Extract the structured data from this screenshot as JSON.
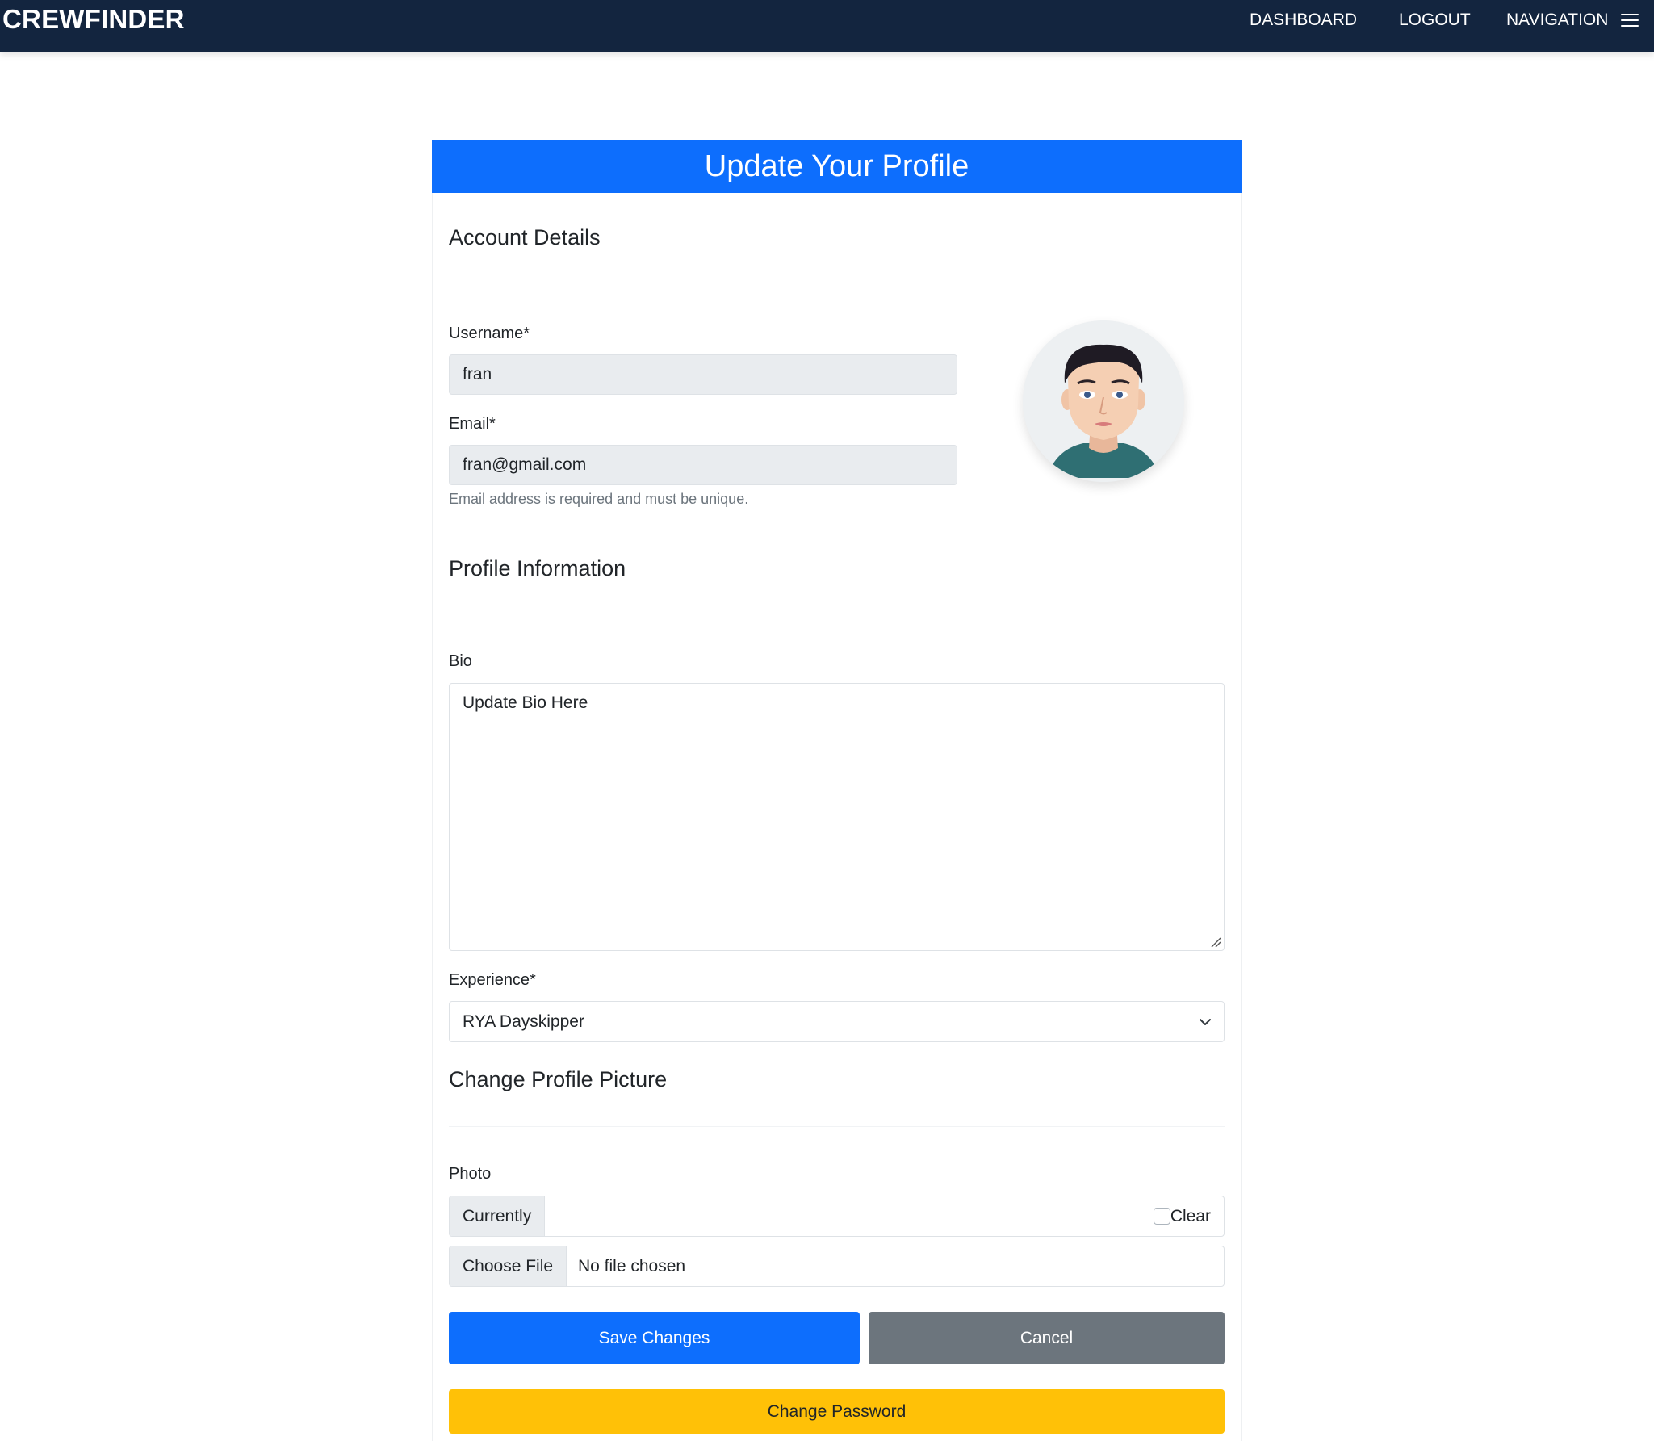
{
  "navbar": {
    "brand": "CREWFINDER",
    "links": [
      "DASHBOARD",
      "LOGOUT",
      "NAVIGATION"
    ],
    "menu_icon": "hamburger-menu-icon",
    "background": "#13253f"
  },
  "header": {
    "title": "Update Your Profile",
    "background": "#0d6efd"
  },
  "account": {
    "title": "Account Details",
    "username_label": "Username*",
    "username_value": "fran",
    "email_label": "Email*",
    "email_value": "fran@gmail.com",
    "email_help": "Email address is required and must be unique."
  },
  "profile": {
    "title": "Profile Information",
    "bio_label": "Bio",
    "bio_value": "Update Bio Here",
    "experience_label": "Experience*",
    "experience_value": "RYA Dayskipper"
  },
  "picture": {
    "title": "Change Profile Picture",
    "photo_label": "Photo",
    "currently_label": "Currently",
    "clear_label": "Clear",
    "choose_file_label": "Choose File",
    "file_status": "No file chosen"
  },
  "buttons": {
    "save": "Save Changes",
    "cancel": "Cancel",
    "change_password": "Change Password",
    "save_color": "#0d6efd",
    "cancel_color": "#6c757d",
    "password_color": "#ffc107"
  }
}
